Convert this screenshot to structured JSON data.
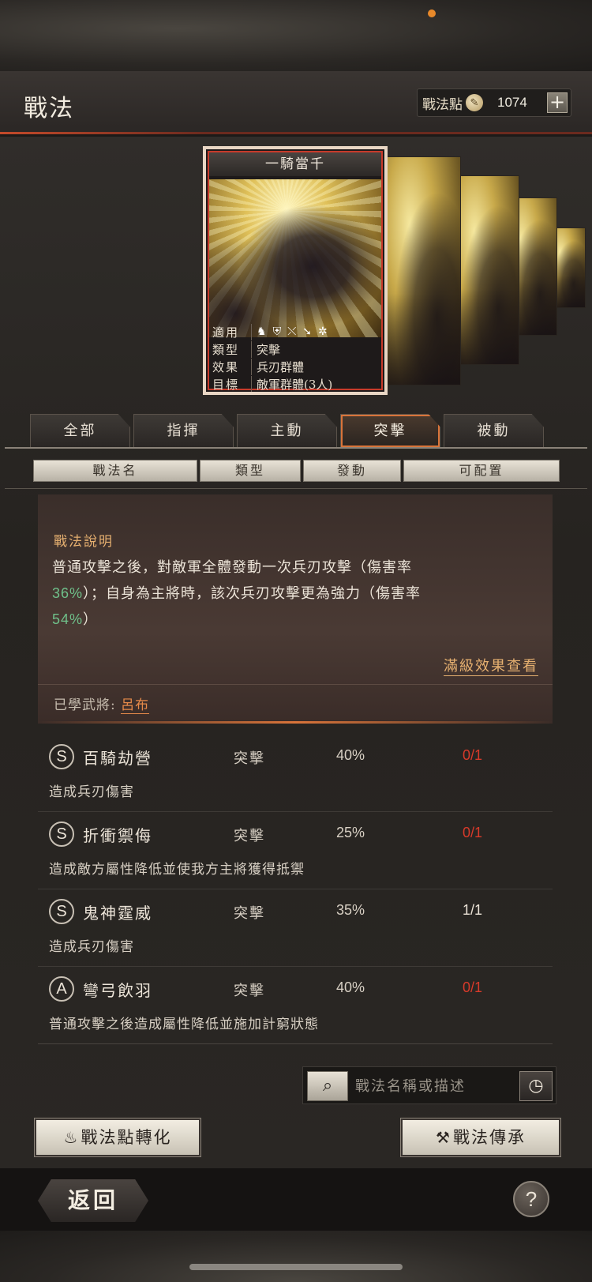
{
  "header": {
    "title": "戰法",
    "points_label": "戰法點",
    "points_value": "1074",
    "plus_label": "+"
  },
  "card": {
    "name": "一騎當千",
    "rows": [
      {
        "key": "適用",
        "value": ""
      },
      {
        "key": "類型",
        "value": "突擊"
      },
      {
        "key": "效果",
        "value": "兵刃群體"
      },
      {
        "key": "目標",
        "value": "敵軍群體(3人)"
      }
    ],
    "icons": [
      "cavalry-icon",
      "shield-icon",
      "bow-icon",
      "spear-icon",
      "wheel-icon"
    ]
  },
  "tabs": [
    "全部",
    "指揮",
    "主動",
    "突擊",
    "被動"
  ],
  "active_tab": "突擊",
  "columns": [
    "戰法名",
    "類型",
    "發動",
    "可配置"
  ],
  "description": {
    "title": "戰法說明",
    "line1": "普通攻擊之後，對敵軍全體發動一次兵刃攻擊（傷害率",
    "pct1": "36%",
    "line2": "）；自身為主將時，該次兵刃攻擊更為強力（傷害率",
    "pct2": "54%",
    "line3": "）",
    "max_level_link": "滿級效果查看",
    "learned_label": "已學武將:",
    "learned_name": "呂布"
  },
  "skills": [
    {
      "grade": "S",
      "name": "百騎劫營",
      "type": "突擊",
      "rate": "40%",
      "count": "0/1",
      "count_color": "red",
      "desc": "造成兵刃傷害"
    },
    {
      "grade": "S",
      "name": "折衝禦侮",
      "type": "突擊",
      "rate": "25%",
      "count": "0/1",
      "count_color": "red",
      "desc": "造成敵方屬性降低並使我方主將獲得抵禦"
    },
    {
      "grade": "S",
      "name": "鬼神霆威",
      "type": "突擊",
      "rate": "35%",
      "count": "1/1",
      "count_color": "white",
      "desc": "造成兵刃傷害"
    },
    {
      "grade": "A",
      "name": "彎弓飲羽",
      "type": "突擊",
      "rate": "40%",
      "count": "0/1",
      "count_color": "red",
      "desc": "普通攻擊之後造成屬性降低並施加計窮狀態"
    }
  ],
  "search": {
    "placeholder": "戰法名稱或描述"
  },
  "buttons": {
    "convert": "戰法點轉化",
    "inherit": "戰法傳承",
    "back": "返回",
    "help": "?"
  },
  "colors": {
    "accent_orange": "#d9743a",
    "red_count": "#d83a2a",
    "green_pct": "#6fc08a"
  }
}
